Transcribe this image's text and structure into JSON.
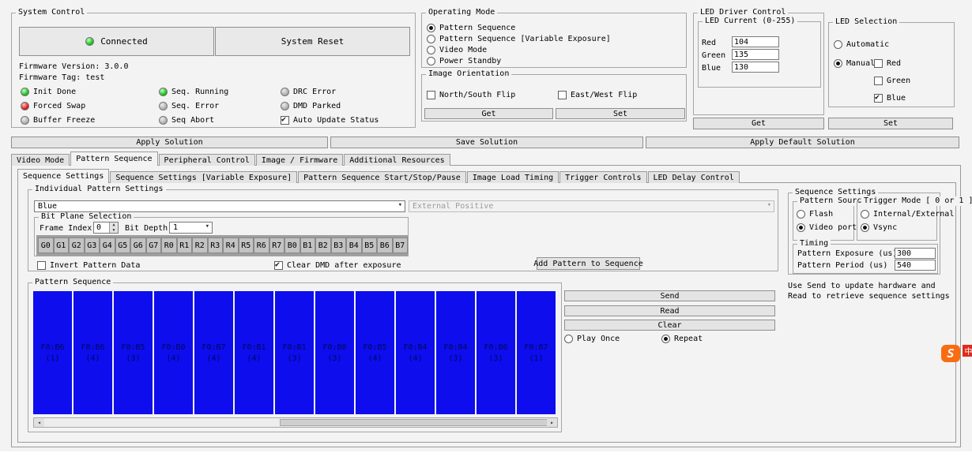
{
  "system_control": {
    "title": "System Control",
    "connected": "Connected",
    "system_reset": "System Reset",
    "firmware_version": "Firmware Version: 3.0.0",
    "firmware_tag": "Firmware Tag: test",
    "status_col1": [
      {
        "label": "Init Done",
        "color": "green"
      },
      {
        "label": "Forced Swap",
        "color": "red"
      },
      {
        "label": "Buffer Freeze",
        "color": "off"
      }
    ],
    "status_col2": [
      {
        "label": "Seq. Running",
        "color": "green"
      },
      {
        "label": "Seq. Error",
        "color": "off"
      },
      {
        "label": "Seq Abort",
        "color": "off"
      }
    ],
    "status_col3": [
      {
        "label": "DRC Error",
        "color": "off"
      },
      {
        "label": "DMD Parked",
        "color": "off"
      }
    ],
    "auto_update": {
      "label": "Auto Update Status",
      "state": "checked"
    }
  },
  "operating_mode": {
    "title": "Operating Mode",
    "options": [
      {
        "label": "Pattern Sequence",
        "state": "on"
      },
      {
        "label": "Pattern Sequence [Variable Exposure]",
        "state": ""
      },
      {
        "label": "Video Mode",
        "state": ""
      },
      {
        "label": "Power Standby",
        "state": ""
      }
    ]
  },
  "image_orientation": {
    "title": "Image Orientation",
    "north_south": {
      "label": "North/South Flip",
      "state": ""
    },
    "east_west": {
      "label": "East/West Flip",
      "state": ""
    },
    "get_button": "Get",
    "set_button": "Set"
  },
  "led_driver": {
    "title": "LED Driver Control",
    "current_title": "LED Current (0-255)",
    "channels": [
      {
        "label": "Red",
        "value": "104"
      },
      {
        "label": "Green",
        "value": "135"
      },
      {
        "label": "Blue",
        "value": "130"
      }
    ],
    "get_button": "Get",
    "set_button": "Set"
  },
  "led_selection": {
    "title": "LED Selection",
    "automatic": {
      "label": "Automatic",
      "state": ""
    },
    "manual": {
      "label": "Manual",
      "state": "on"
    },
    "colors": [
      {
        "label": "Red",
        "state": ""
      },
      {
        "label": "Green",
        "state": ""
      },
      {
        "label": "Blue",
        "state": "checked"
      }
    ]
  },
  "solution_buttons": {
    "apply": "Apply Solution",
    "save": "Save Solution",
    "apply_default": "Apply Default Solution"
  },
  "main_tabs": [
    {
      "label": "Video Mode",
      "state": ""
    },
    {
      "label": "Pattern Sequence",
      "state": "active"
    },
    {
      "label": "Peripheral Control",
      "state": ""
    },
    {
      "label": "Image / Firmware",
      "state": ""
    },
    {
      "label": "Additional Resources",
      "state": ""
    }
  ],
  "sub_tabs": [
    {
      "label": "Sequence Settings",
      "state": "active"
    },
    {
      "label": "Sequence Settings [Variable Exposure]",
      "state": ""
    },
    {
      "label": "Pattern Sequence Start/Stop/Pause",
      "state": ""
    },
    {
      "label": "Image Load Timing",
      "state": ""
    },
    {
      "label": "Trigger Controls",
      "state": ""
    },
    {
      "label": "LED Delay Control",
      "state": ""
    }
  ],
  "individual_pattern": {
    "title": "Individual Pattern Settings",
    "color_select": "Blue",
    "trigger_select": "External Positive",
    "bit_plane": {
      "title": "Bit Plane Selection",
      "frame_index_label": "Frame Index",
      "frame_index_value": "0",
      "bit_depth_label": "Bit Depth",
      "bit_depth_value": "1",
      "bits": [
        "G0",
        "G1",
        "G2",
        "G3",
        "G4",
        "G5",
        "G6",
        "G7",
        "R0",
        "R1",
        "R2",
        "R3",
        "R4",
        "R5",
        "R6",
        "R7",
        "B0",
        "B1",
        "B2",
        "B3",
        "B4",
        "B5",
        "B6",
        "B7"
      ]
    },
    "invert": {
      "label": "Invert Pattern Data",
      "state": ""
    },
    "clear_dmd": {
      "label": "Clear DMD after exposure",
      "state": "checked"
    },
    "add_button": "Add Pattern to Sequence"
  },
  "sequence_settings_panel": {
    "title": "Sequence Settings",
    "pattern_source": {
      "title": "Pattern Source",
      "options": [
        {
          "label": "Flash",
          "state": ""
        },
        {
          "label": "Video port",
          "state": "on"
        }
      ]
    },
    "trigger_mode": {
      "title": "Trigger Mode [ 0 or 1 ]",
      "options": [
        {
          "label": "Internal/External",
          "state": ""
        },
        {
          "label": "Vsync",
          "state": "on"
        }
      ]
    },
    "timing": {
      "title": "Timing",
      "rows": [
        {
          "label": "Pattern Exposure (us)",
          "value": "300"
        },
        {
          "label": "Pattern Period (us)",
          "value": "540"
        }
      ]
    },
    "note": "Use Send to update hardware and Read to retrieve sequence settings"
  },
  "pattern_sequence": {
    "title": "Pattern Sequence",
    "tiles": [
      {
        "label": "F0:B6",
        "depth": "(1)"
      },
      {
        "label": "F0:B6",
        "depth": "(4)"
      },
      {
        "label": "F0:B5",
        "depth": "(3)"
      },
      {
        "label": "F0:B0",
        "depth": "(4)"
      },
      {
        "label": "F0:B7",
        "depth": "(4)"
      },
      {
        "label": "F0:B1",
        "depth": "(4)"
      },
      {
        "label": "F0:B1",
        "depth": "(3)"
      },
      {
        "label": "F0:B0",
        "depth": "(3)"
      },
      {
        "label": "F0:B5",
        "depth": "(4)"
      },
      {
        "label": "F0:B4",
        "depth": "(4)"
      },
      {
        "label": "F0:B4",
        "depth": "(3)"
      },
      {
        "label": "F0:B6",
        "depth": "(3)"
      },
      {
        "label": "F0:B7",
        "depth": "(1)"
      }
    ],
    "send": "Send",
    "read": "Read",
    "clear": "Clear",
    "play_once": {
      "label": "Play Once",
      "state": ""
    },
    "repeat": {
      "label": "Repeat",
      "state": "on"
    }
  },
  "watermark": {
    "s": "S",
    "zh": "中"
  }
}
